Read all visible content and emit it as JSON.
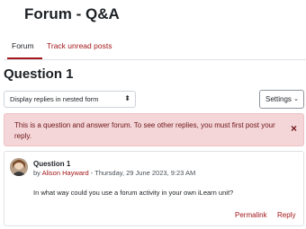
{
  "page": {
    "title": "Forum - Q&A"
  },
  "tabs": [
    {
      "label": "Forum"
    },
    {
      "label": "Track unread posts"
    }
  ],
  "section": {
    "heading": "Question 1"
  },
  "controls": {
    "display_mode": "Display replies in nested form",
    "settings_label": "Settings"
  },
  "alert": {
    "message": "This is a question and answer forum. To see other replies, you must first post your reply.",
    "close_glyph": "×"
  },
  "post": {
    "title": "Question 1",
    "by_prefix": "by ",
    "author": "Alison Hayward",
    "date": " - Thursday, 29 June 2023, 9:23 AM",
    "body": "In what way could you use a forum activity in your own iLearn unit?",
    "permalink_label": "Permalink",
    "reply_label": "Reply"
  },
  "colors": {
    "accent": "#a3161a",
    "alert_bg": "#f4d6d8",
    "alert_text": "#6e1518"
  }
}
